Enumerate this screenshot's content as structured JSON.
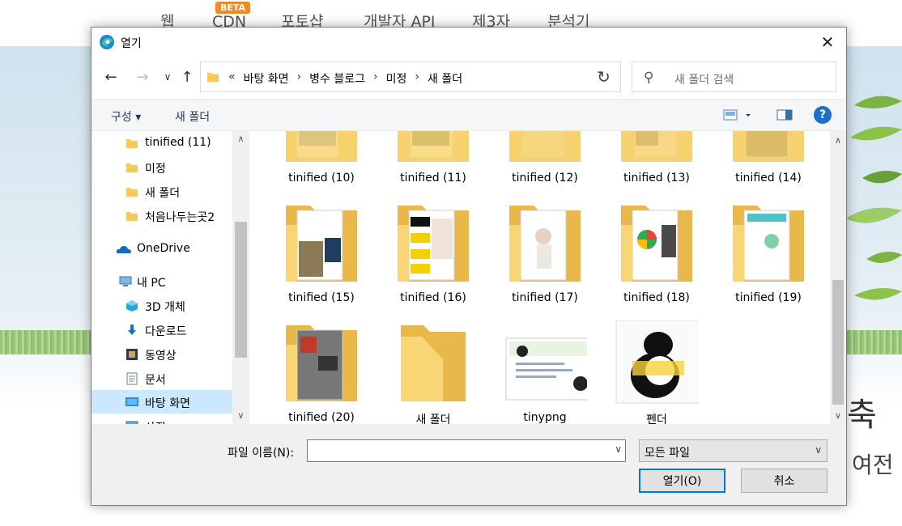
{
  "background": {
    "nav": [
      "웹",
      "CDN",
      "포토샵",
      "개발자 API",
      "제3자",
      "분석기"
    ],
    "beta": "BETA",
    "big_text": "축",
    "sub_text": "여전"
  },
  "dialog": {
    "title": "열기",
    "address": {
      "overflow": "«",
      "crumbs": [
        "바탕 화면",
        "병수 블로그",
        "미정",
        "새 폴더"
      ]
    },
    "search_placeholder": "새 폴더 검색",
    "commands": {
      "organize": "구성 ▾",
      "new_folder": "새 폴더"
    },
    "sidebar": [
      {
        "label": "tinified (11)",
        "icon": "folder-icon"
      },
      {
        "label": "미정",
        "icon": "folder-icon"
      },
      {
        "label": "새 폴더",
        "icon": "folder-icon"
      },
      {
        "label": "처음나두는곳2",
        "icon": "folder-icon"
      },
      {
        "label": "OneDrive",
        "icon": "onedrive-icon"
      },
      {
        "label": "내 PC",
        "icon": "pc-icon"
      },
      {
        "label": "3D 개체",
        "icon": "3d-objects-icon"
      },
      {
        "label": "다운로드",
        "icon": "download-icon"
      },
      {
        "label": "동영상",
        "icon": "video-icon"
      },
      {
        "label": "문서",
        "icon": "document-icon"
      },
      {
        "label": "바탕 화면",
        "icon": "desktop-icon"
      },
      {
        "label": "사진",
        "icon": "pictures-icon"
      }
    ],
    "files": [
      {
        "label": "tinified (10)"
      },
      {
        "label": "tinified (11)"
      },
      {
        "label": "tinified (12)"
      },
      {
        "label": "tinified (13)"
      },
      {
        "label": "tinified (14)"
      },
      {
        "label": "tinified (15)"
      },
      {
        "label": "tinified (16)"
      },
      {
        "label": "tinified (17)"
      },
      {
        "label": "tinified (18)"
      },
      {
        "label": "tinified (19)"
      },
      {
        "label": "tinified (20)"
      },
      {
        "label": "새 폴더"
      },
      {
        "label": "tinypng"
      },
      {
        "label": "펜더"
      }
    ],
    "filename_label": "파일 이름(N):",
    "filename_value": "",
    "filetype": "모든 파일",
    "open_button": "열기(O)",
    "cancel_button": "취소"
  }
}
